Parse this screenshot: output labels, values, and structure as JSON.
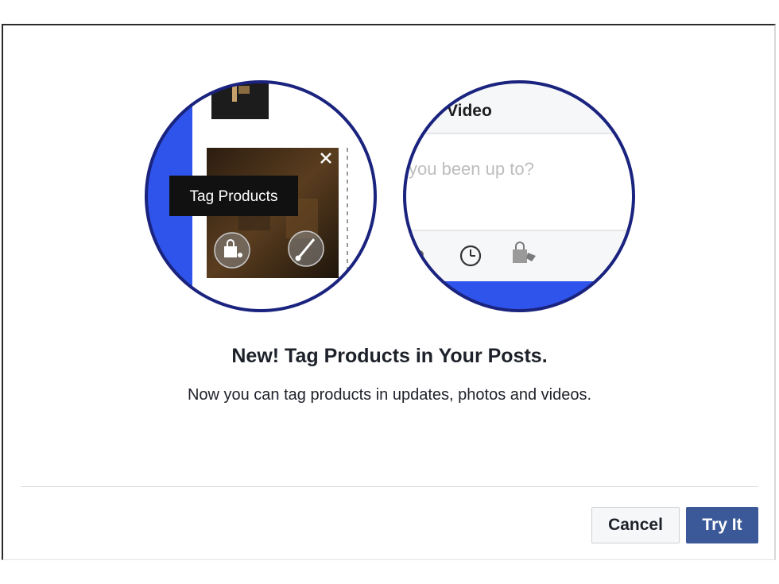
{
  "illustration": {
    "tooltip": "Tag Products",
    "composer_tab": "Video",
    "composer_placeholder": "you been up to?"
  },
  "dialog": {
    "title": "New! Tag Products in Your Posts.",
    "description": "Now you can tag products in updates, photos and videos.",
    "cancel_label": "Cancel",
    "confirm_label": "Try It"
  },
  "colors": {
    "accent_blue": "#3b5998",
    "circle_outline": "#1a237e",
    "bright_blue": "#2f54eb"
  },
  "icons": {
    "close": "close-icon",
    "shopping_bag": "shopping-bag-icon",
    "paintbrush": "paintbrush-icon",
    "clock": "clock-icon",
    "bag_tag": "shopping-bag-tag-icon"
  }
}
